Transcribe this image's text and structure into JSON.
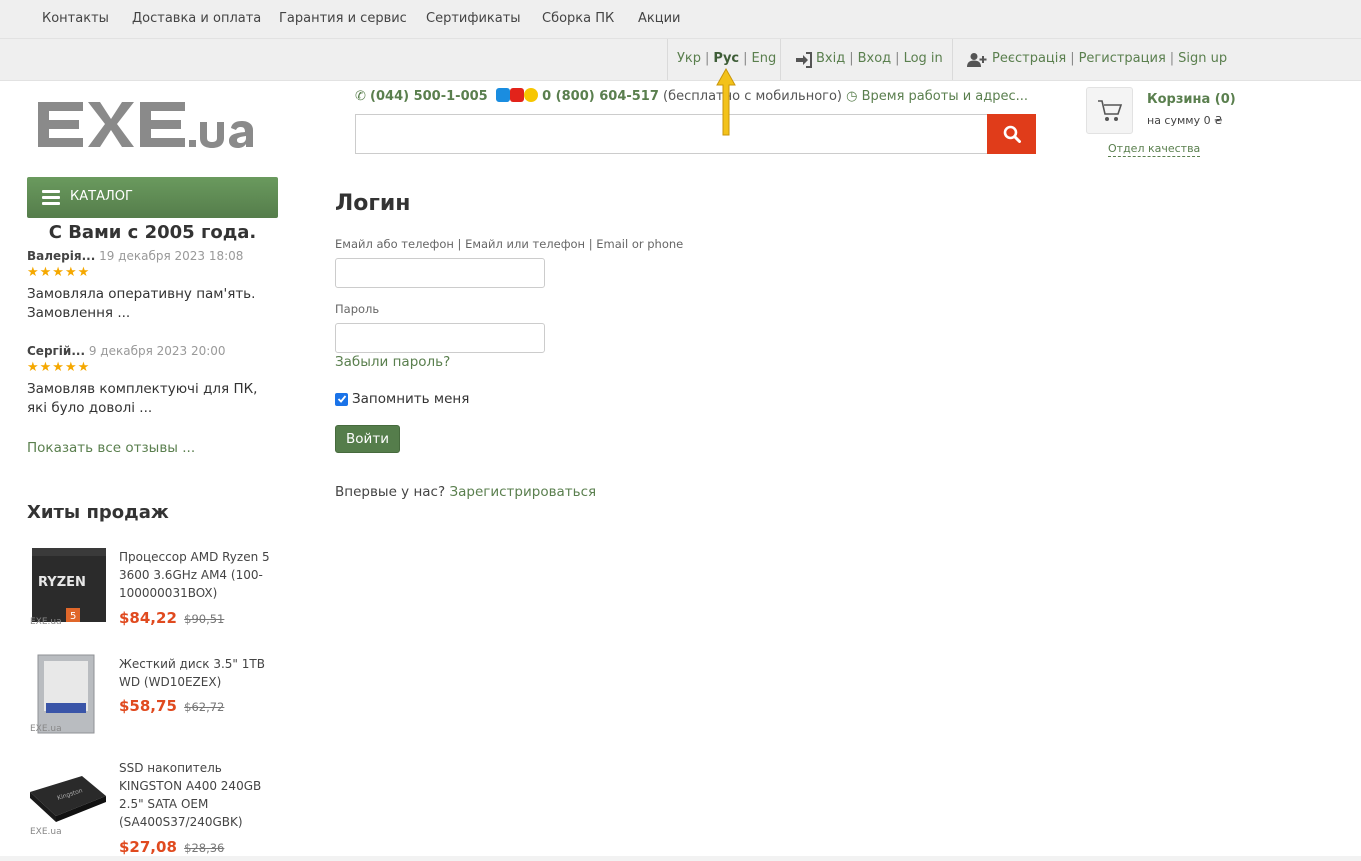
{
  "topnav": [
    "Контакты",
    "Доставка и оплата",
    "Гарантия и сервис",
    "Сертификаты",
    "Сборка ПК",
    "Акции"
  ],
  "lang": {
    "ukr": "Укр",
    "rus": "Рус",
    "eng": "Eng",
    "active": "Рус"
  },
  "auth": {
    "login_ukr": "Вхід",
    "login_rus": "Вход",
    "login_eng": "Log in",
    "reg_ukr": "Реєстрація",
    "reg_rus": "Регистрация",
    "reg_eng": "Sign up"
  },
  "header": {
    "logo_text": "EXE.ua",
    "phone1": "(044) 500-1-005",
    "phone2": "0 (800) 604-517",
    "phone2_note": "(бесплатно с мобильного)",
    "hours_link": "Время работы и адрес...",
    "search_placeholder": ""
  },
  "cart": {
    "title": "Корзина (0)",
    "sum": "на сумму 0 ₴",
    "quality_link": "Отдел качества"
  },
  "sidebar": {
    "catalog_label": "КАТАЛОГ",
    "since": "С Вами с 2005 года.",
    "reviews": [
      {
        "name": "Валерія...",
        "date": "19 декабря 2023 18:08",
        "stars": "★★★★★",
        "text": "Замовляла оперативну пам'ять. Замовлення ..."
      },
      {
        "name": "Сергій...",
        "date": "9 декабря 2023 20:00",
        "stars": "★★★★★",
        "text": "Замовляв комплектуючі для ПК, які було доволі ..."
      }
    ],
    "show_all": "Показать все отзывы ...",
    "hits_title": "Хиты продаж",
    "products": [
      {
        "name": "Процессор AMD Ryzen 5 3600 3.6GHz AM4 (100-100000031BOX)",
        "price": "$84,22",
        "old_price": "$90,51"
      },
      {
        "name": "Жесткий диск 3.5\" 1TB WD (WD10EZEX)",
        "price": "$58,75",
        "old_price": "$62,72"
      },
      {
        "name": "SSD накопитель KINGSTON A400 240GB 2.5\" SATA OEM (SA400S37/240GBK)",
        "price": "$27,08",
        "old_price": "$28,36"
      }
    ]
  },
  "login": {
    "title": "Логин",
    "email_label": "Емайл або телефон | Емайл или телефон | Email or phone",
    "email_value": "",
    "password_label": "Пароль",
    "password_value": "",
    "forgot": "Забыли пароль?",
    "remember": "Запомнить меня",
    "remember_checked": true,
    "submit": "Войти",
    "first_time": "Впервые у нас?",
    "register_link": "Зарегистрироваться"
  },
  "colors": {
    "brand_green": "#5a7f4e",
    "search_red": "#e03c1a",
    "price_red": "#e04a1f",
    "arrow_yellow": "#f3c21a"
  }
}
